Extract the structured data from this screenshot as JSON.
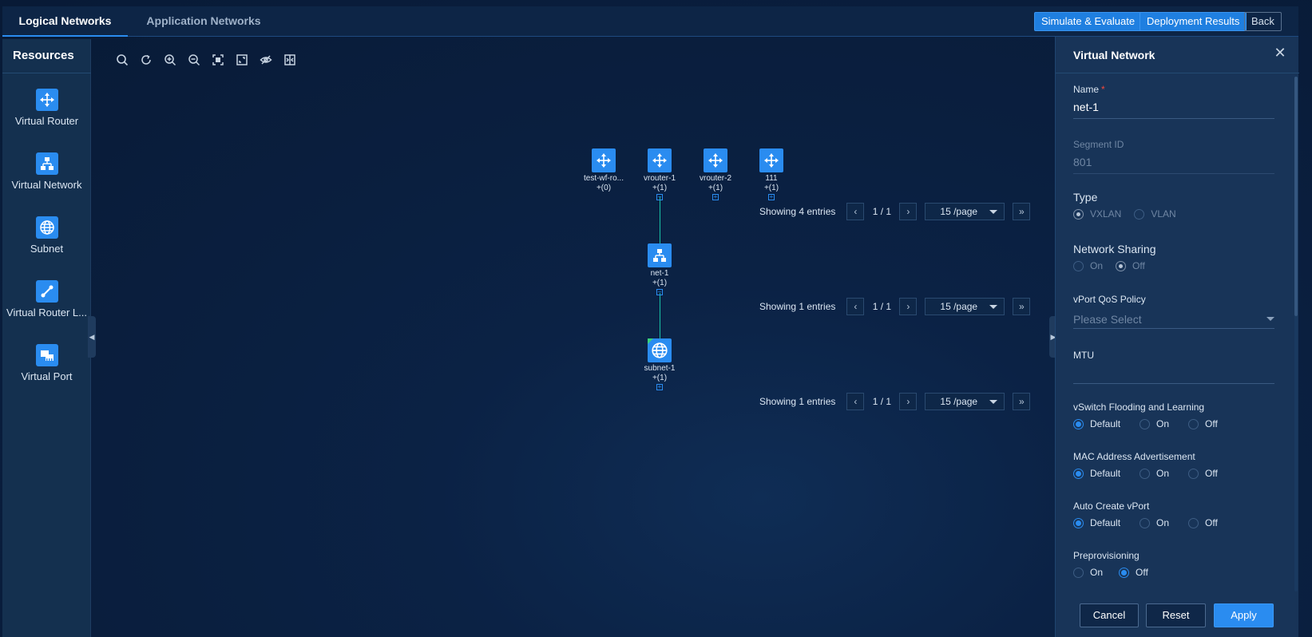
{
  "tabs": [
    {
      "label": "Logical Networks",
      "active": true
    },
    {
      "label": "Application Networks",
      "active": false
    }
  ],
  "header_buttons": {
    "simulate": "Simulate & Evaluate",
    "deployment": "Deployment Results",
    "back": "Back"
  },
  "resources": {
    "title": "Resources",
    "items": [
      {
        "label": "Virtual Router",
        "icon": "router-icon"
      },
      {
        "label": "Virtual Network",
        "icon": "network-icon"
      },
      {
        "label": "Subnet",
        "icon": "globe-icon"
      },
      {
        "label": "Virtual Router L...",
        "icon": "link-icon"
      },
      {
        "label": "Virtual Port",
        "icon": "port-icon"
      }
    ]
  },
  "toolbar": [
    "search-icon",
    "refresh-icon",
    "zoom-in-icon",
    "zoom-out-icon",
    "fit-icon",
    "fullscreen-icon",
    "hide-icon",
    "split-icon"
  ],
  "topology": {
    "routers": [
      {
        "label": "test-wf-ro...",
        "count": "+(0)",
        "toggle": ""
      },
      {
        "label": "vrouter-1",
        "count": "+(1)",
        "toggle": "−"
      },
      {
        "label": "vrouter-2",
        "count": "+(1)",
        "toggle": "+"
      },
      {
        "label": "111",
        "count": "+(1)",
        "toggle": "+"
      }
    ],
    "network": {
      "label": "net-1",
      "count": "+(1)",
      "toggle": "−"
    },
    "subnet": {
      "label": "subnet-1",
      "count": "+(1)",
      "toggle": "+"
    },
    "pagers": [
      {
        "showing": "Showing 4 entries",
        "page": "1 / 1",
        "size": "15 /page"
      },
      {
        "showing": "Showing 1 entries",
        "page": "1 / 1",
        "size": "15 /page"
      },
      {
        "showing": "Showing 1 entries",
        "page": "1 / 1",
        "size": "15 /page"
      }
    ]
  },
  "panel": {
    "title": "Virtual Network",
    "name_label": "Name",
    "name_required": "*",
    "name_value": "net-1",
    "segment_label": "Segment ID",
    "segment_value": "801",
    "type_label": "Type",
    "type_options": [
      "VXLAN",
      "VLAN"
    ],
    "type_selected": "VXLAN",
    "sharing_label": "Network Sharing",
    "sharing_options": [
      "On",
      "Off"
    ],
    "sharing_selected": "Off",
    "qos_label": "vPort QoS Policy",
    "qos_placeholder": "Please Select",
    "mtu_label": "MTU",
    "mtu_value": "",
    "flooding_label": "vSwitch Flooding and Learning",
    "flooding_options": [
      "Default",
      "On",
      "Off"
    ],
    "flooding_selected": "Default",
    "mac_label": "MAC Address Advertisement",
    "mac_options": [
      "Default",
      "On",
      "Off"
    ],
    "mac_selected": "Default",
    "autovport_label": "Auto Create vPort",
    "autovport_options": [
      "Default",
      "On",
      "Off"
    ],
    "autovport_selected": "Default",
    "preprov_label": "Preprovisioning",
    "preprov_options": [
      "On",
      "Off"
    ],
    "preprov_selected": "Off",
    "cancel": "Cancel",
    "reset": "Reset",
    "apply": "Apply"
  },
  "colors": {
    "accent": "#2a8cf0",
    "link": "#18c1a5",
    "background": "#0a1f3f",
    "panel": "#183458"
  }
}
